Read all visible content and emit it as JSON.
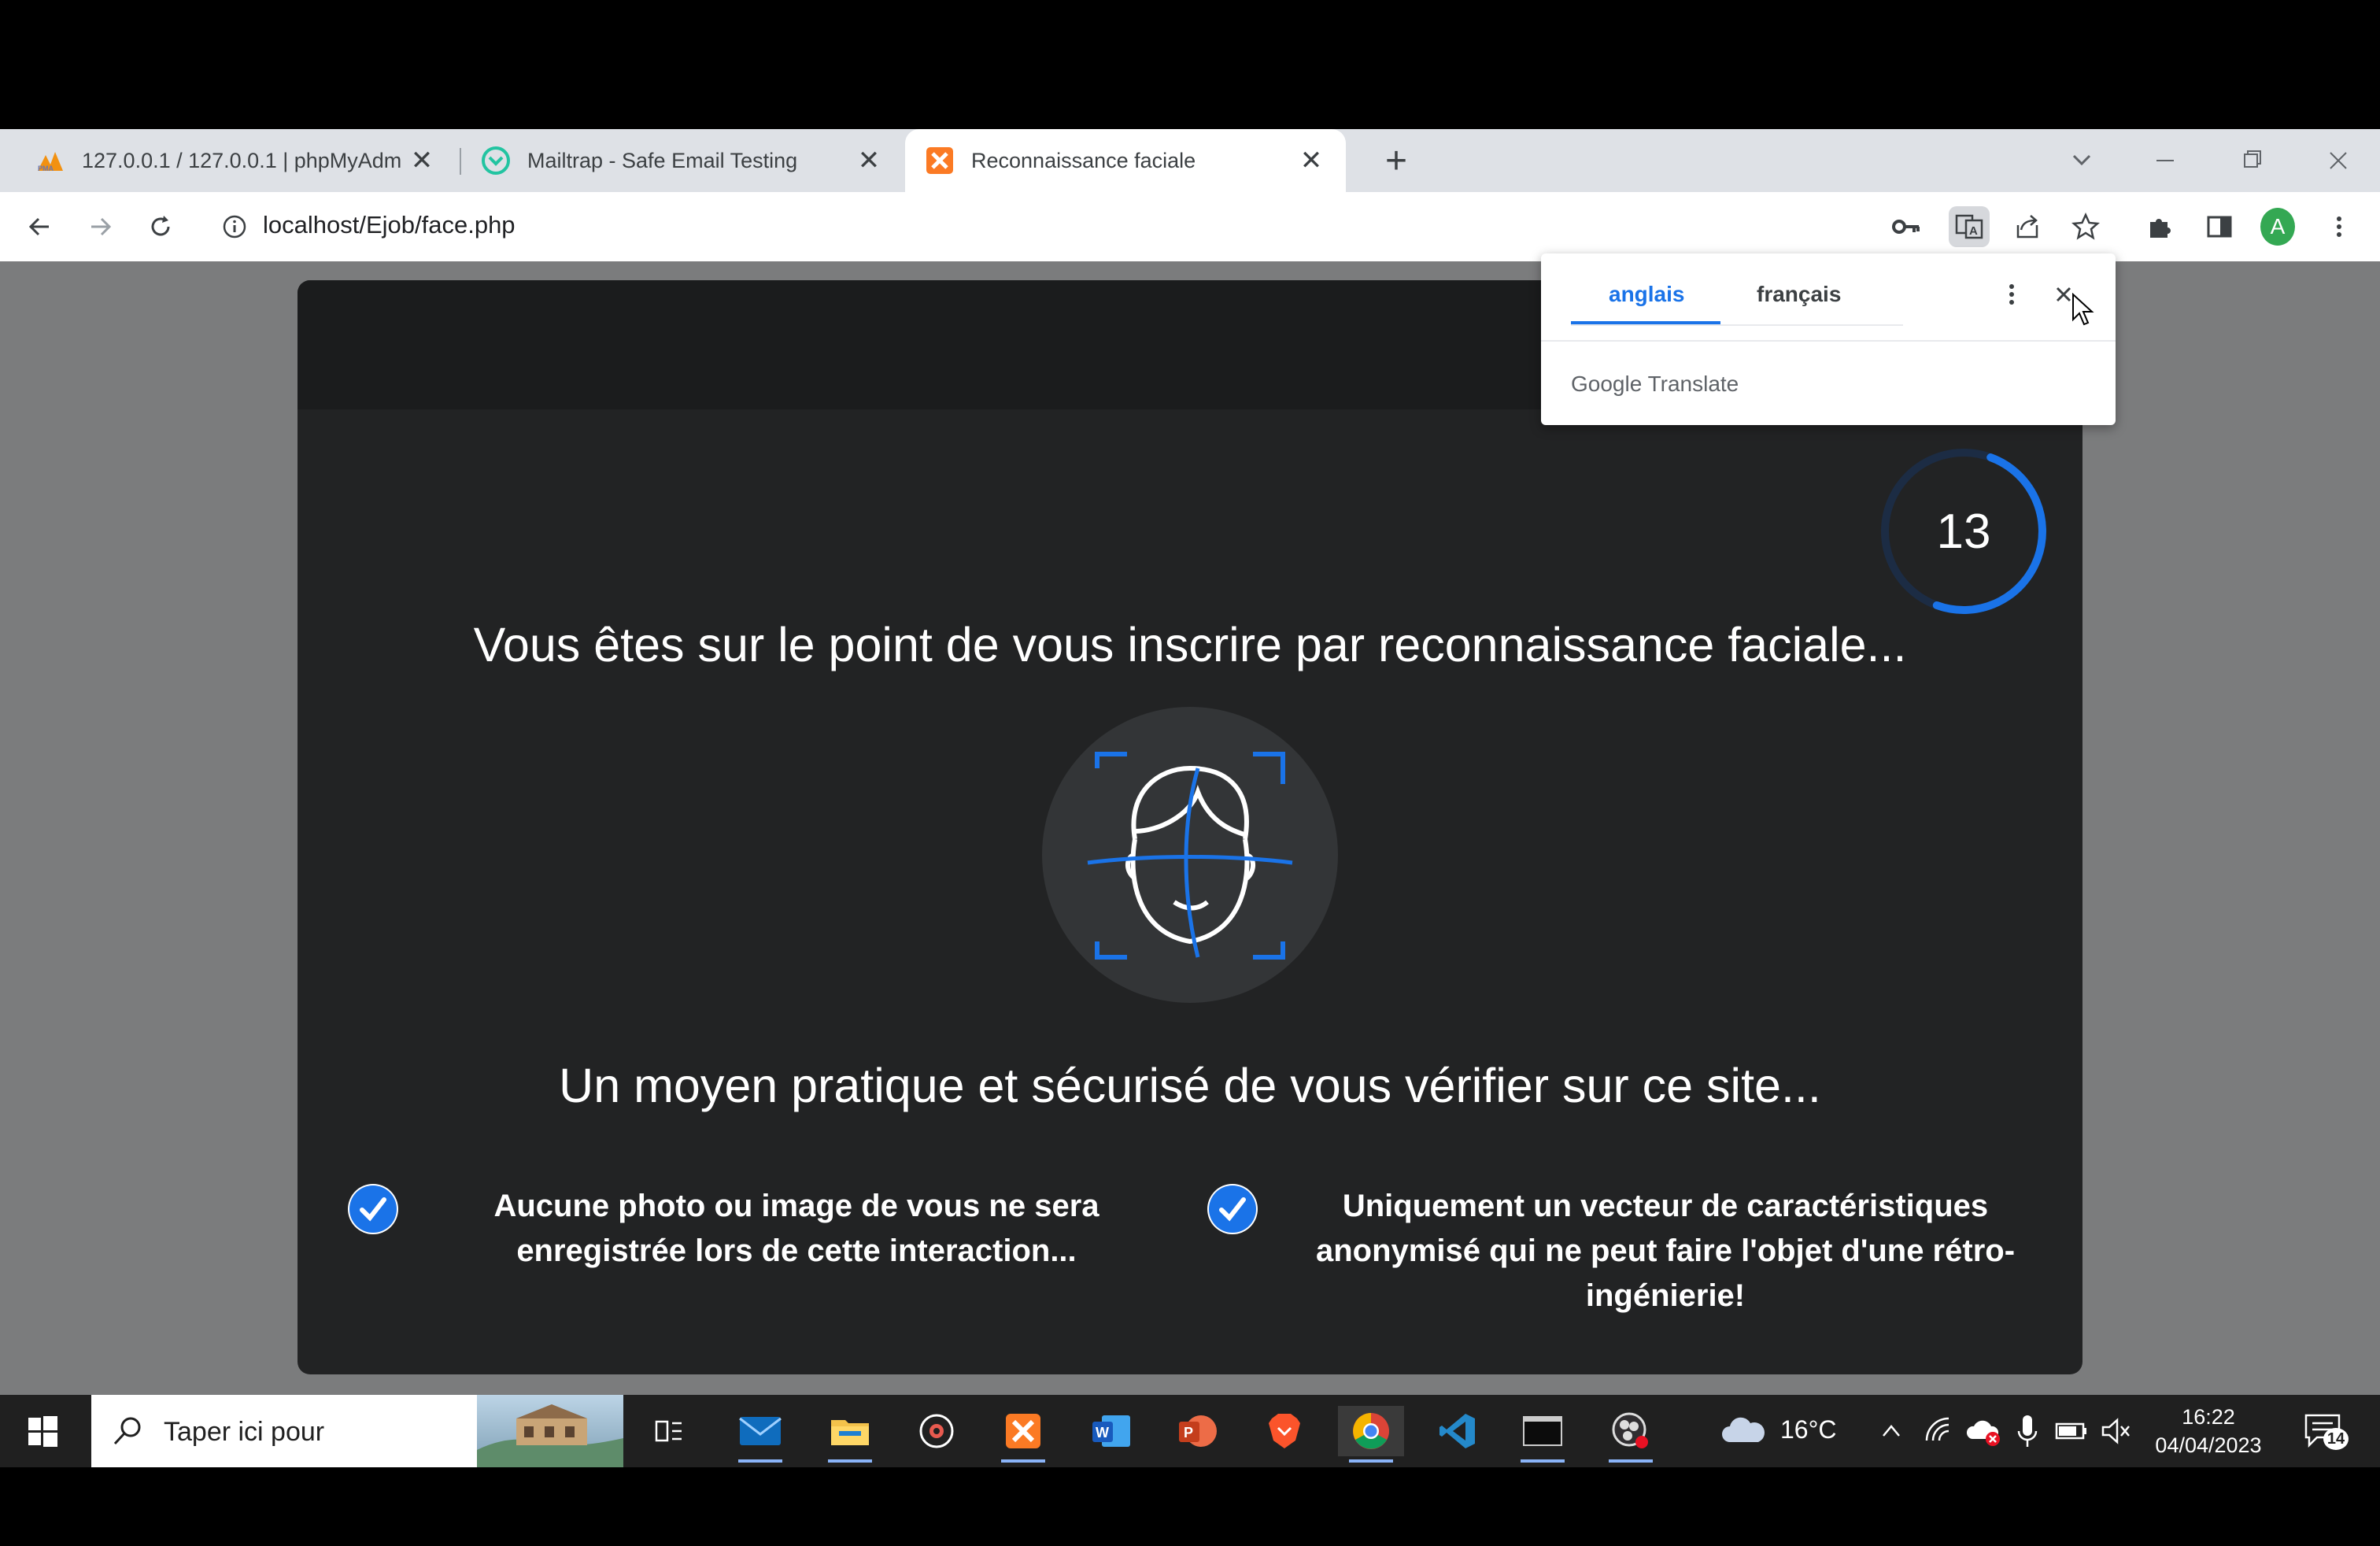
{
  "browser": {
    "tabs": [
      {
        "title": "127.0.0.1 / 127.0.0.1 | phpMyAdmin",
        "favicon": "phpmyadmin-icon"
      },
      {
        "title": "Mailtrap - Safe Email Testing",
        "favicon": "mailtrap-icon"
      },
      {
        "title": "Reconnaissance faciale",
        "favicon": "xampp-icon",
        "active": true
      }
    ],
    "url": "localhost/Ejob/face.php",
    "profile_initial": "A"
  },
  "translate_popup": {
    "source_lang": "anglais",
    "target_lang": "français",
    "brand": "Google",
    "product": "Translate"
  },
  "page": {
    "countdown": "13",
    "heading": "Vous êtes sur le point de vous inscrire par reconnaissance faciale...",
    "subheading": "Un moyen pratique et sécurisé de vous vérifier sur ce site...",
    "features": [
      {
        "text": "Aucune photo ou image de vous ne sera enregistrée lors de cette interaction..."
      },
      {
        "text": "Uniquement un vecteur de caractéristiques anonymisé qui ne peut faire l'objet d'une rétro-ingénierie!"
      }
    ],
    "accent_color": "#1a73e8"
  },
  "taskbar": {
    "search_placeholder": "Taper ici pour",
    "weather": "16°C",
    "time": "16:22",
    "date": "04/04/2023",
    "notifications": "14"
  }
}
